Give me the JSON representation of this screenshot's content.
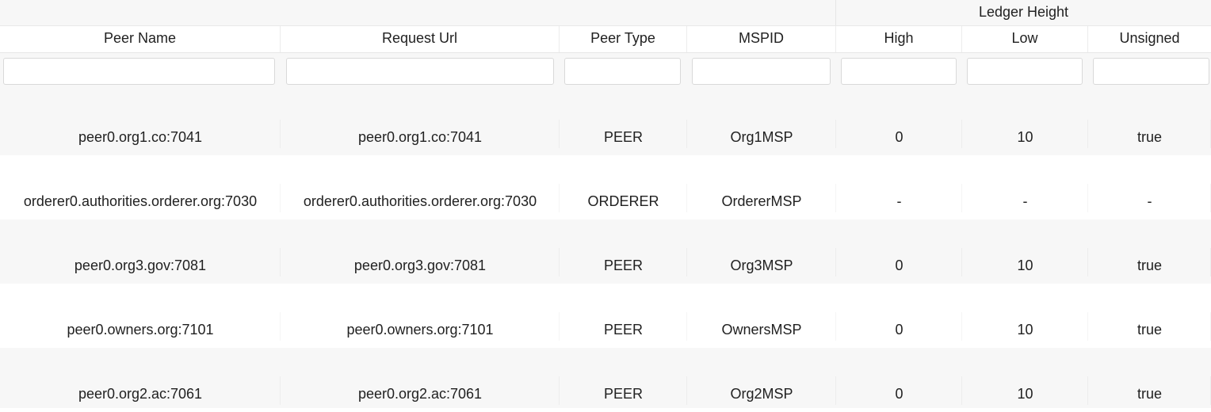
{
  "group_header": {
    "label": "Ledger Height"
  },
  "columns": {
    "peer_name": "Peer Name",
    "request_url": "Request Url",
    "peer_type": "Peer Type",
    "mspid": "MSPID",
    "high": "High",
    "low": "Low",
    "unsigned": "Unsigned"
  },
  "filters": {
    "peer_name": "",
    "request_url": "",
    "peer_type": "",
    "mspid": "",
    "high": "",
    "low": "",
    "unsigned": ""
  },
  "rows": [
    {
      "peer_name": "peer0.org1.co:7041",
      "request_url": "peer0.org1.co:7041",
      "peer_type": "PEER",
      "mspid": "Org1MSP",
      "high": "0",
      "low": "10",
      "unsigned": "true"
    },
    {
      "peer_name": "orderer0.authorities.orderer.org:7030",
      "request_url": "orderer0.authorities.orderer.org:7030",
      "peer_type": "ORDERER",
      "mspid": "OrdererMSP",
      "high": "-",
      "low": "-",
      "unsigned": "-"
    },
    {
      "peer_name": "peer0.org3.gov:7081",
      "request_url": "peer0.org3.gov:7081",
      "peer_type": "PEER",
      "mspid": "Org3MSP",
      "high": "0",
      "low": "10",
      "unsigned": "true"
    },
    {
      "peer_name": "peer0.owners.org:7101",
      "request_url": "peer0.owners.org:7101",
      "peer_type": "PEER",
      "mspid": "OwnersMSP",
      "high": "0",
      "low": "10",
      "unsigned": "true"
    },
    {
      "peer_name": "peer0.org2.ac:7061",
      "request_url": "peer0.org2.ac:7061",
      "peer_type": "PEER",
      "mspid": "Org2MSP",
      "high": "0",
      "low": "10",
      "unsigned": "true"
    }
  ]
}
